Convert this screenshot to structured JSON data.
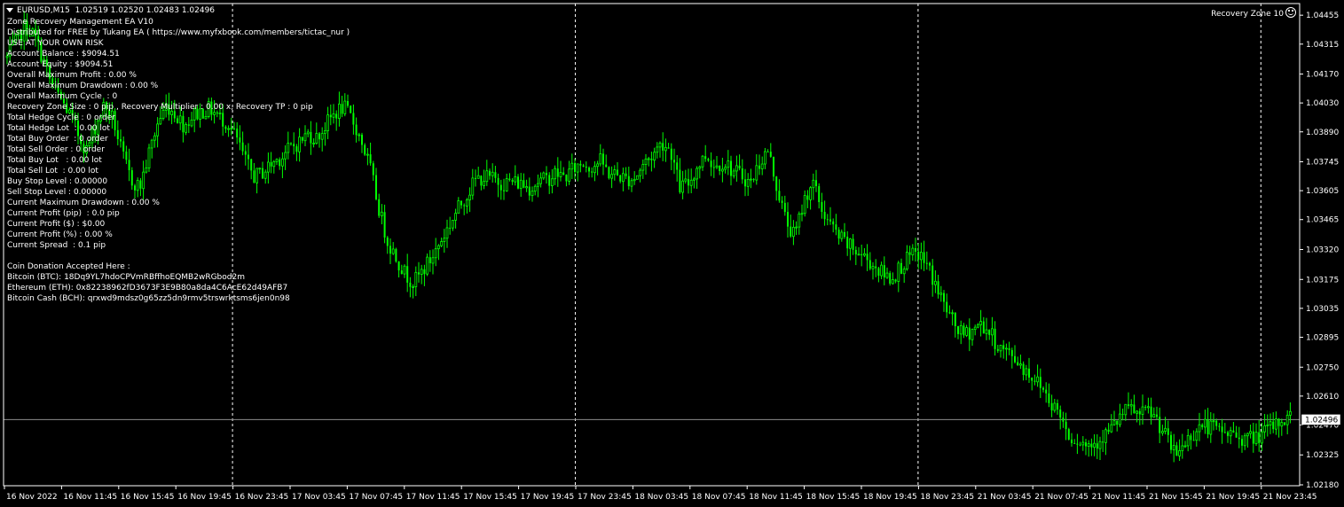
{
  "header": {
    "symbol": "EURUSD,M15",
    "ohlc": "1.02519 1.02520 1.02483 1.02496"
  },
  "ea_info": [
    "Zone Recovery Management EA V10",
    "Distributed for FREE by Tukang EA ( https://www.myfxbook.com/members/tictac_nur )",
    "USE AT YOUR OWN RISK",
    "Account Balance : $9094.51",
    "Account Equity : $9094.51",
    "Overall Maximum Profit : 0.00 %",
    "Overall Maximum Drawdown : 0.00 %",
    "Overall Maximum Cycle  : 0",
    "Recovery Zone Size : 0 pip , Recovery Multiplier : 0.00 x, Recovery TP : 0 pip",
    "Total Hedge Cycle : 0 order",
    "Total Hedge Lot  : 0.00 lot",
    "Total Buy Order  : 0 order",
    "Total Sell Order : 0 order",
    "Total Buy Lot   : 0.00 lot",
    "Total Sell Lot  : 0.00 lot",
    "Buy Stop Level : 0.00000",
    "Sell Stop Level : 0.00000",
    "Current Maximum Drawdown : 0.00 %",
    "Current Profit (pip)  : 0.0 pip",
    "Current Profit ($) : $0.00",
    "Current Profit (%) : 0.00 %",
    "Current Spread  : 0.1 pip",
    "",
    "Coin Donation Accepted Here :",
    "Bitcoin (BTC): 18Dq9YL7hdoCPVmRBffhoEQMB2wRGbod2m",
    "Ethereum (ETH): 0x82238962fD3673F3E9B80a8da4C6AcE62d49AFB7",
    "Bitcoin Cash (BCH): qrxwd9mdsz0g65zz5dn9rmv5trswrktsms6jen0n98"
  ],
  "zone_label": "Recovery Zone 10",
  "icons": {
    "smile": "smile-icon",
    "menu": "dropdown-triangle-icon"
  },
  "colors": {
    "background": "#000000",
    "candle": "#00ff00",
    "axis": "#ffffff",
    "separator": "#ffffff",
    "bid_line": "#8c8c8c"
  },
  "chart_data": {
    "type": "candlestick",
    "symbol": "EURUSD",
    "timeframe": "M15",
    "current_price": 1.02496,
    "ylim": [
      1.0218,
      1.0446
    ],
    "price_ticks": [
      "1.04455",
      "1.04315",
      "1.04170",
      "1.04030",
      "1.03890",
      "1.03745",
      "1.03605",
      "1.03465",
      "1.03320",
      "1.03175",
      "1.03035",
      "1.02895",
      "1.02750",
      "1.02610",
      "1.02470",
      "1.02325",
      "1.02180"
    ],
    "time_ticks": [
      "16 Nov 2022",
      "16 Nov 11:45",
      "16 Nov 15:45",
      "16 Nov 19:45",
      "16 Nov 23:45",
      "17 Nov 03:45",
      "17 Nov 07:45",
      "17 Nov 11:45",
      "17 Nov 15:45",
      "17 Nov 19:45",
      "17 Nov 23:45",
      "18 Nov 03:45",
      "18 Nov 07:45",
      "18 Nov 11:45",
      "18 Nov 15:45",
      "18 Nov 19:45",
      "18 Nov 23:45",
      "21 Nov 03:45",
      "21 Nov 07:45",
      "21 Nov 11:45",
      "21 Nov 15:45",
      "21 Nov 19:45",
      "21 Nov 23:45"
    ],
    "day_separators_at": [
      "16 Nov 23:45",
      "17 Nov 23:45",
      "18 Nov 23:45",
      "21 Nov 23:45"
    ],
    "close_path": [
      1.0425,
      1.0432,
      1.044,
      1.0436,
      1.0425,
      1.0412,
      1.0405,
      1.0398,
      1.0388,
      1.038,
      1.0392,
      1.0402,
      1.0395,
      1.0378,
      1.0366,
      1.0362,
      1.0378,
      1.0393,
      1.0402,
      1.0398,
      1.0392,
      1.0397,
      1.0399,
      1.04,
      1.0396,
      1.0393,
      1.0385,
      1.0374,
      1.0367,
      1.037,
      1.0374,
      1.0377,
      1.0381,
      1.0384,
      1.0388,
      1.0386,
      1.0392,
      1.0398,
      1.0401,
      1.0395,
      1.0385,
      1.0372,
      1.0352,
      1.0336,
      1.0328,
      1.032,
      1.0316,
      1.0322,
      1.0328,
      1.0336,
      1.0344,
      1.0352,
      1.0359,
      1.0366,
      1.0367,
      1.0366,
      1.0364,
      1.0365,
      1.0364,
      1.0362,
      1.0365,
      1.0366,
      1.0369,
      1.0367,
      1.0371,
      1.0374,
      1.0372,
      1.0375,
      1.0369,
      1.0368,
      1.0366,
      1.0367,
      1.0374,
      1.0378,
      1.0384,
      1.038,
      1.0362,
      1.0364,
      1.0372,
      1.0378,
      1.0372,
      1.0375,
      1.037,
      1.0368,
      1.0364,
      1.0374,
      1.038,
      1.0362,
      1.0346,
      1.0338,
      1.0355,
      1.0365,
      1.0352,
      1.0344,
      1.0338,
      1.0334,
      1.0331,
      1.0328,
      1.0324,
      1.032,
      1.0318,
      1.0324,
      1.0328,
      1.033,
      1.0324,
      1.0314,
      1.0304,
      1.0296,
      1.029,
      1.0293,
      1.0296,
      1.0292,
      1.0285,
      1.0282,
      1.0279,
      1.0274,
      1.027,
      1.0265,
      1.0258,
      1.0252,
      1.0242,
      1.024,
      1.0237,
      1.0239,
      1.0242,
      1.0246,
      1.0252,
      1.0255,
      1.0251,
      1.0254,
      1.0249,
      1.0241,
      1.0232,
      1.0238,
      1.0243,
      1.0247,
      1.0246,
      1.0244,
      1.0243,
      1.0242,
      1.024,
      1.0241,
      1.0243,
      1.0246,
      1.0249,
      1.0251
    ]
  }
}
